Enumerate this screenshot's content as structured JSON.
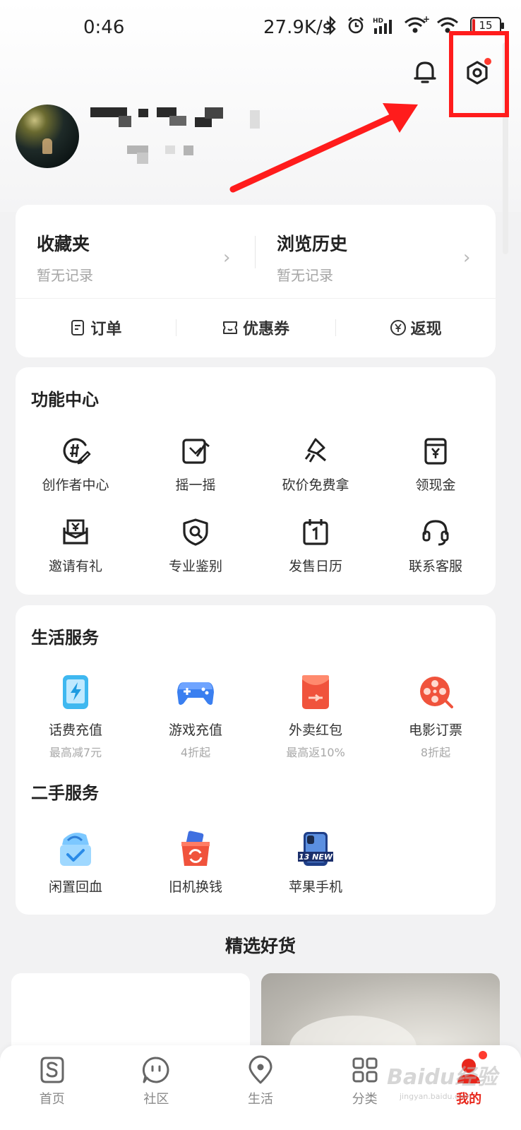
{
  "status_bar": {
    "time": "0:46",
    "net_speed": "27.9K/s",
    "battery": "15"
  },
  "records": {
    "favorites": {
      "title": "收藏夹",
      "sub": "暂无记录"
    },
    "history": {
      "title": "浏览历史",
      "sub": "暂无记录"
    },
    "quick_links": [
      {
        "label": "订单",
        "icon": "order-icon"
      },
      {
        "label": "优惠券",
        "icon": "coupon-icon"
      },
      {
        "label": "返现",
        "icon": "cashback-icon"
      }
    ]
  },
  "function_center": {
    "title": "功能中心",
    "items": [
      {
        "label": "创作者中心",
        "icon": "creator-icon"
      },
      {
        "label": "摇一摇",
        "icon": "shake-icon"
      },
      {
        "label": "砍价免费拿",
        "icon": "bargain-icon"
      },
      {
        "label": "领现金",
        "icon": "cash-icon"
      },
      {
        "label": "邀请有礼",
        "icon": "invite-icon"
      },
      {
        "label": "专业鉴别",
        "icon": "authenticate-icon"
      },
      {
        "label": "发售日历",
        "icon": "calendar-icon"
      },
      {
        "label": "联系客服",
        "icon": "headset-icon"
      }
    ]
  },
  "life_services": {
    "title": "生活服务",
    "items": [
      {
        "label": "话费充值",
        "sub": "最高减7元",
        "icon": "phone-recharge-icon"
      },
      {
        "label": "游戏充值",
        "sub": "4折起",
        "icon": "gamepad-icon"
      },
      {
        "label": "外卖红包",
        "sub": "最高返10%",
        "icon": "red-envelope-icon"
      },
      {
        "label": "电影订票",
        "sub": "8折起",
        "icon": "film-reel-icon"
      }
    ]
  },
  "second_hand": {
    "title": "二手服务",
    "items": [
      {
        "label": "闲置回血",
        "icon": "idle-resale-icon"
      },
      {
        "label": "旧机换钱",
        "icon": "trade-in-icon"
      },
      {
        "label": "苹果手机",
        "icon": "iphone-icon",
        "badge": "13 NEW"
      }
    ]
  },
  "featured": {
    "title": "精选好货"
  },
  "bottom_nav": [
    {
      "label": "首页",
      "icon": "home-icon"
    },
    {
      "label": "社区",
      "icon": "community-icon"
    },
    {
      "label": "生活",
      "icon": "location-icon"
    },
    {
      "label": "分类",
      "icon": "category-icon"
    },
    {
      "label": "我的",
      "icon": "profile-icon",
      "active": true
    }
  ],
  "watermark": {
    "text": "Baidu经验",
    "sub": "jingyan.baidu.com"
  },
  "colors": {
    "accent": "#e8261b",
    "highlight": "#ff1c1c",
    "badge_dot": "#ff3b30"
  }
}
